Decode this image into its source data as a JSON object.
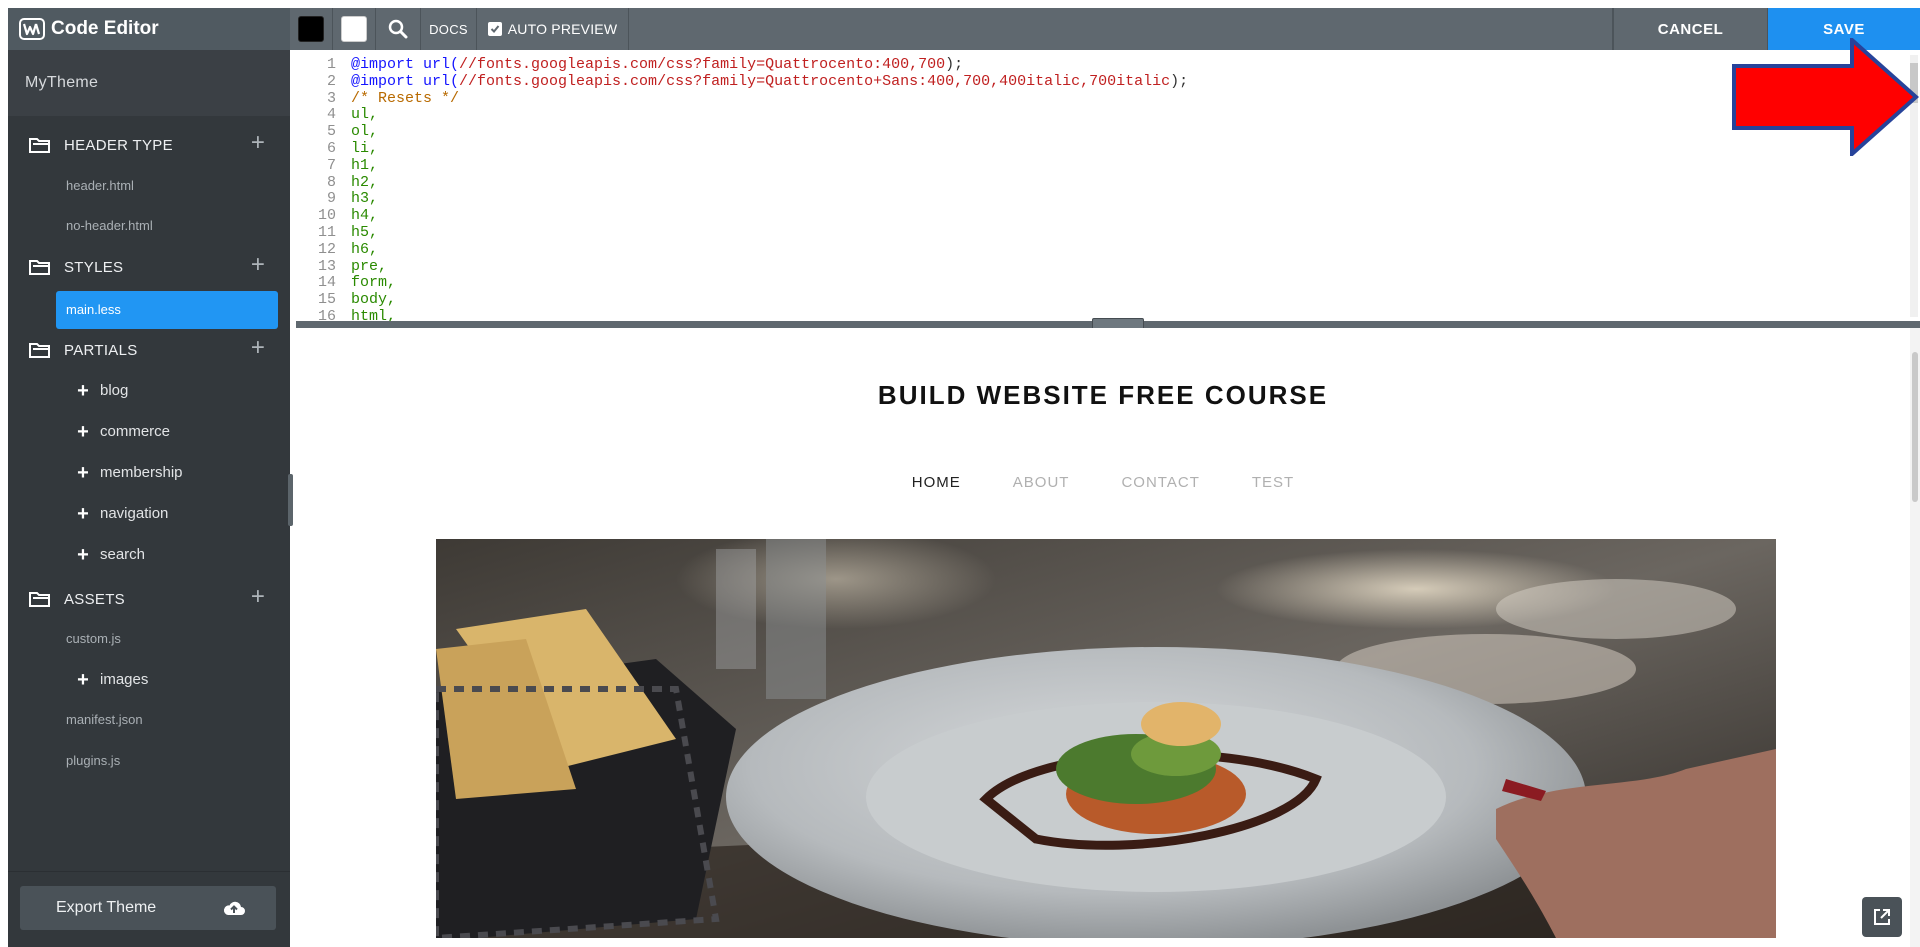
{
  "app": {
    "title": "Code Editor",
    "theme_name": "MyTheme"
  },
  "sidebar": {
    "sections": [
      {
        "label": "HEADER TYPE",
        "files": [
          "header.html",
          "no-header.html"
        ]
      },
      {
        "label": "STYLES",
        "files": [
          "main.less"
        ],
        "active_file": "main.less"
      },
      {
        "label": "PARTIALS",
        "folders": [
          "blog",
          "commerce",
          "membership",
          "navigation",
          "search"
        ]
      },
      {
        "label": "ASSETS",
        "files": [
          "custom.js",
          "manifest.json",
          "plugins.js"
        ],
        "folders": [
          "images"
        ]
      }
    ],
    "export_label": "Export Theme"
  },
  "toolbar": {
    "docs_label": "DOCS",
    "auto_preview_label": "AUTO PREVIEW",
    "auto_preview_checked": true,
    "cancel_label": "CANCEL",
    "save_label": "SAVE",
    "swatch_dark": "#000000",
    "swatch_light": "#ffffff"
  },
  "editor": {
    "line_numbers": [
      "1",
      "2",
      "3",
      "4",
      "5",
      "6",
      "7",
      "8",
      "9",
      "10",
      "11",
      "12",
      "13",
      "14",
      "15",
      "16"
    ],
    "lines": [
      "@import url(//fonts.googleapis.com/css?family=Quattrocento:400,700);",
      "@import url(//fonts.googleapis.com/css?family=Quattrocento+Sans:400,700,400italic,700italic);",
      "/* Resets */",
      "ul,",
      "ol,",
      "li,",
      "h1,",
      "h2,",
      "h3,",
      "h4,",
      "h5,",
      "h6,",
      "pre,",
      "form,",
      "body,",
      "html,"
    ]
  },
  "preview": {
    "site_title": "BUILD WEBSITE FREE COURSE",
    "nav": [
      "HOME",
      "ABOUT",
      "CONTACT",
      "TEST"
    ],
    "current_nav": "HOME"
  },
  "colors": {
    "sidebar_bg": "#33383c",
    "toolbar_bg": "#5f686f",
    "accent_blue": "#1e90f0",
    "annotation_red": "#ff0000"
  }
}
